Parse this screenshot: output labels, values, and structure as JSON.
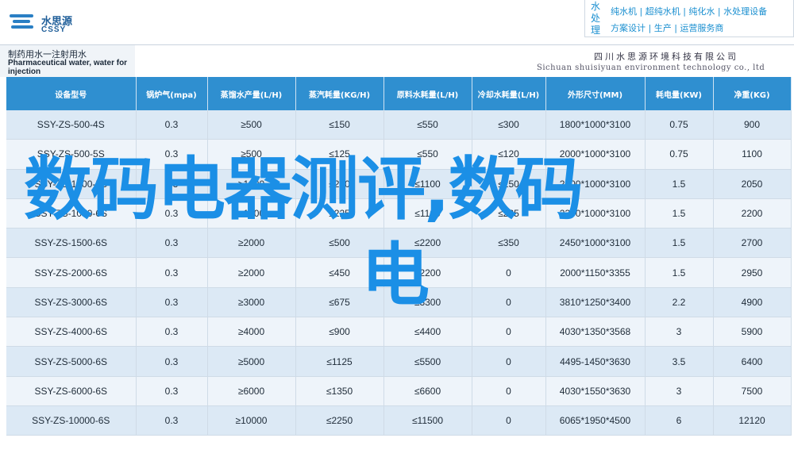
{
  "logo": {
    "cn": "水思源",
    "en": "CSSY"
  },
  "brand": {
    "vertical": [
      "水",
      "处",
      "理"
    ],
    "line1": "纯水机 | 超纯水机 | 纯化水 | 水处理设备",
    "line2": "方案设计 | 生产 | 运营服务商"
  },
  "document": {
    "title_cn": "制药用水一注射用水",
    "title_en": "Pharmaceutical water, water for injection",
    "company_cn": "四川水思源环境科技有限公司",
    "company_en": "Sichuan shuisiyuan environment technology co., ltd"
  },
  "table": {
    "headers": [
      "设备型号",
      "锅炉气(mpa)",
      "蒸馏水产量(L/H)",
      "蒸汽耗量(KG/H)",
      "原料水耗量(L/H)",
      "冷却水耗量(L/H)",
      "外形尺寸(MM)",
      "耗电量(KW)",
      "净重(KG)"
    ],
    "rows": [
      [
        "SSY-ZS-500-4S",
        "0.3",
        "≥500",
        "≤150",
        "≤550",
        "≤300",
        "1800*1000*3100",
        "0.75",
        "900"
      ],
      [
        "SSY-ZS-500-5S",
        "0.3",
        "≥500",
        "≤125",
        "≤550",
        "≤120",
        "2000*1000*3100",
        "0.75",
        "1100"
      ],
      [
        "SSY-ZS-1000-5S",
        "0.3",
        "≥1000",
        "≤250",
        "≤1100",
        "≤250",
        "2200*1000*3100",
        "1.5",
        "2050"
      ],
      [
        "SSY-ZS-1000-6S",
        "0.3",
        "≥1000",
        "≤225",
        "≤1100",
        "≤225",
        "2300*1000*3100",
        "1.5",
        "2200"
      ],
      [
        "SSY-ZS-1500-6S",
        "0.3",
        "≥2000",
        "≤500",
        "≤2200",
        "≤350",
        "2450*1000*3100",
        "1.5",
        "2700"
      ],
      [
        "SSY-ZS-2000-6S",
        "0.3",
        "≥2000",
        "≤450",
        "≤2200",
        "0",
        "2000*1150*3355",
        "1.5",
        "2950"
      ],
      [
        "SSY-ZS-3000-6S",
        "0.3",
        "≥3000",
        "≤675",
        "≤3300",
        "0",
        "3810*1250*3400",
        "2.2",
        "4900"
      ],
      [
        "SSY-ZS-4000-6S",
        "0.3",
        "≥4000",
        "≤900",
        "≤4400",
        "0",
        "4030*1350*3568",
        "3",
        "5900"
      ],
      [
        "SSY-ZS-5000-6S",
        "0.3",
        "≥5000",
        "≤1125",
        "≤5500",
        "0",
        "4495-1450*3630",
        "3.5",
        "6400"
      ],
      [
        "SSY-ZS-6000-6S",
        "0.3",
        "≥6000",
        "≤1350",
        "≤6600",
        "0",
        "4030*1550*3630",
        "3",
        "7500"
      ],
      [
        "SSY-ZS-10000-6S",
        "0.3",
        "≥10000",
        "≤2250",
        "≤11500",
        "0",
        "6065*1950*4500",
        "6",
        "12120"
      ]
    ]
  },
  "overlay": {
    "line1": "数码电器测评,数码",
    "line2": "电"
  }
}
